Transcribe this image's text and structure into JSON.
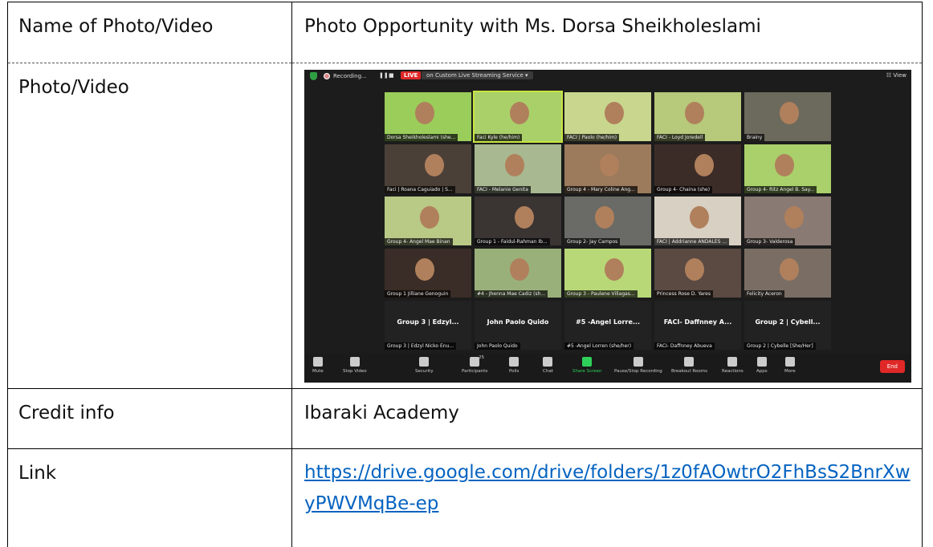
{
  "table": {
    "rows": [
      {
        "label": "Name of Photo/Video",
        "value": "Photo Opportunity with Ms. Dorsa Sheikholeslami"
      },
      {
        "label": "Photo/Video"
      },
      {
        "label": "Credit info",
        "value": "Ibaraki Academy"
      },
      {
        "label": "Link",
        "value": "https://drive.google.com/drive/folders/1z0fAOwtrO2FhBsS2BnrXwyPWVMqBe-ep"
      }
    ]
  },
  "zoom": {
    "recording": "Recording...",
    "live_badge": "LIVE",
    "stream": "on Custom Live Streaming Service ▾",
    "view": "☷ View",
    "tiles": [
      {
        "name": "Dorsa Sheikholeslami (she...",
        "bg": "#9acd5a",
        "active": false
      },
      {
        "name": "Faci Kyle (he/him)",
        "bg": "#aad06a",
        "active": true
      },
      {
        "name": "FACI | Paolo (he/him)",
        "bg": "#c9d78e",
        "active": false
      },
      {
        "name": "FACI - Loyd Joredell",
        "bg": "#b7c97a",
        "active": false
      },
      {
        "name": "Brainy",
        "bg": "#6c6a5c",
        "active": false
      },
      {
        "name": "Faci | Roana Caguiado | S...",
        "bg": "#4b4038",
        "active": false
      },
      {
        "name": "FACI - Melanie Genita",
        "bg": "#a8b890",
        "active": false
      },
      {
        "name": "Group 4 - Mary Coline Ang...",
        "bg": "#9c7a5c",
        "active": false
      },
      {
        "name": "Group 4- Chaina (she)",
        "bg": "#3c2c28",
        "active": false
      },
      {
        "name": "Group 4- Ritz Angel B. Say...",
        "bg": "#a9d06a",
        "active": false
      },
      {
        "name": "Group 4- Angel Mae Binan",
        "bg": "#b9c986",
        "active": false
      },
      {
        "name": "Group 1 - Faidul-Rahman Ib...",
        "bg": "#3a3432",
        "active": false
      },
      {
        "name": "Group 2- Jay Campos",
        "bg": "#6a6a66",
        "active": false
      },
      {
        "name": "FACI | Addrianne ANDALES ...",
        "bg": "#d8d0c2",
        "active": false
      },
      {
        "name": "Group 3- Valderosa",
        "bg": "#8a7a74",
        "active": false
      },
      {
        "name": "Group 1 Jilliane Genoguin",
        "bg": "#3a2c26",
        "active": false
      },
      {
        "name": "#4 - Jhenna Mae Cadiz (sh...",
        "bg": "#9ab07a",
        "active": false
      },
      {
        "name": "Group 3 - Paulene Villagas...",
        "bg": "#b8d878",
        "active": false
      },
      {
        "name": "Princess Rose D. Yares",
        "bg": "#5a4a42",
        "active": false
      },
      {
        "name": "Felicity Aceron",
        "bg": "#7a6e64",
        "active": false
      }
    ],
    "name_tiles": [
      {
        "big": "Group 3 | Edzyl...",
        "name": "Group 3 | Edzyl Nicko Enu..."
      },
      {
        "big": "John Paolo Quido",
        "name": "John Paolo Quido"
      },
      {
        "big": "#5 -Angel Lorre...",
        "name": "#5 -Angel Lorren (she/her)"
      },
      {
        "big": "FACI- Daffnney A...",
        "name": "FACI- Daffnney Abueva"
      },
      {
        "big": "Group 2 | Cybell...",
        "name": "Group 2 | Cybelle [She/Her]"
      }
    ],
    "toolbar": {
      "mute": "Mute",
      "stop_video": "Stop Video",
      "security": "Security",
      "participants": "Participants",
      "participants_count": "25",
      "polls": "Polls",
      "chat": "Chat",
      "share": "Share Screen",
      "pause_rec": "Pause/Stop Recording",
      "breakout": "Breakout Rooms",
      "reactions": "Reactions",
      "apps": "Apps",
      "more": "More",
      "end": "End"
    }
  }
}
